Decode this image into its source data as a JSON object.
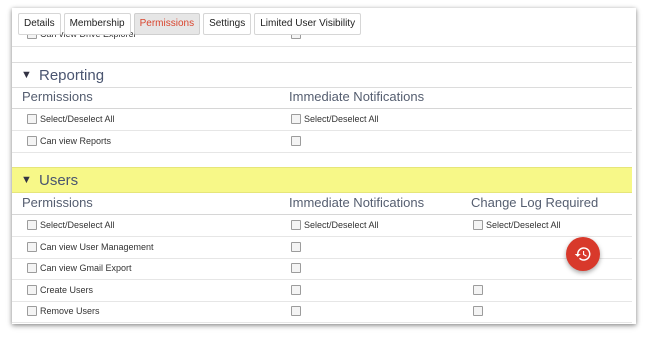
{
  "tabs": [
    {
      "label": "Details",
      "active": false
    },
    {
      "label": "Membership",
      "active": false
    },
    {
      "label": "Permissions",
      "active": true
    },
    {
      "label": "Settings",
      "active": false
    },
    {
      "label": "Limited User Visibility",
      "active": false
    }
  ],
  "cutoff_row": {
    "label": "Can view Drive Explorer"
  },
  "reporting": {
    "title": "Reporting",
    "col_permissions": "Permissions",
    "col_notifications": "Immediate Notifications",
    "select_all": "Select/Deselect All",
    "select_all_notif": "Select/Deselect All",
    "rows": [
      {
        "label": "Can view Reports"
      }
    ]
  },
  "users": {
    "title": "Users",
    "col_permissions": "Permissions",
    "col_notifications": "Immediate Notifications",
    "col_changelog": "Change Log Required",
    "select_all": "Select/Deselect All",
    "select_all_notif": "Select/Deselect All",
    "select_all_changelog": "Select/Deselect All",
    "rows": [
      {
        "label": "Can view User Management"
      },
      {
        "label": "Can view Gmail Export"
      },
      {
        "label": "Create Users"
      },
      {
        "label": "Remove Users"
      }
    ]
  },
  "icons": {
    "fab": "history-icon",
    "section_toggle": "triangle-down-icon"
  },
  "colors": {
    "accent": "#d8392b",
    "highlight": "#f7f888",
    "active_tab_text": "#d9452e"
  }
}
